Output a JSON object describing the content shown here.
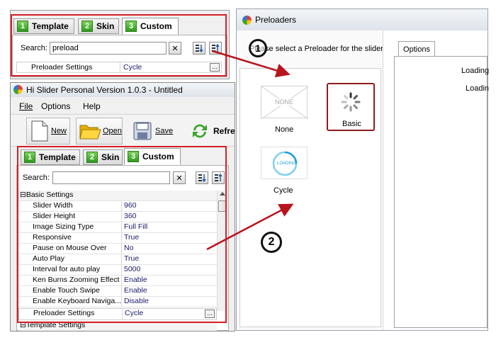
{
  "top_panel": {
    "tabs": [
      {
        "num": "1",
        "label": "Template"
      },
      {
        "num": "2",
        "label": "Skin"
      },
      {
        "num": "3",
        "label": "Custom"
      }
    ],
    "search_label": "Search:",
    "search_value": "preload",
    "clear_glyph": "✕",
    "row": {
      "name": "Preloader Settings",
      "value": "Cycle",
      "button": "..."
    }
  },
  "main_window": {
    "title": "Hi Slider Personal Version 1.0.3  - Untitled",
    "menu": [
      "File",
      "Options",
      "Help"
    ],
    "toolbar": [
      "New",
      "Open",
      "Save",
      "Refre"
    ],
    "tabs": [
      {
        "num": "1",
        "label": "Template"
      },
      {
        "num": "2",
        "label": "Skin"
      },
      {
        "num": "3",
        "label": "Custom"
      }
    ],
    "search_label": "Search:",
    "search_value": "",
    "clear_glyph": "✕",
    "group": "Basic Settings",
    "group_toggle": "⊟",
    "rows": [
      {
        "name": "Slider Width",
        "value": "960"
      },
      {
        "name": "Slider Height",
        "value": "360"
      },
      {
        "name": "Image Sizing Type",
        "value": "Full Fill"
      },
      {
        "name": "Responsive",
        "value": "True"
      },
      {
        "name": "Pause on Mouse Over",
        "value": "No"
      },
      {
        "name": "Auto Play",
        "value": "True"
      },
      {
        "name": "Interval for auto play",
        "value": "5000"
      },
      {
        "name": "Ken Burns Zooming Effect",
        "value": "Enable"
      },
      {
        "name": "Enable Touch Swipe",
        "value": "Enable"
      },
      {
        "name": "Enable Keyboard Naviga...",
        "value": "Disable"
      },
      {
        "name": "Preloader Settings",
        "value": "Cycle"
      }
    ],
    "ellipsis": "...",
    "next_group": "Template Settings",
    "next_group_toggle": "⊟"
  },
  "preloaders": {
    "title": "Preloaders",
    "instruction": "Please select a Preloader for the slider.",
    "options_tab": "Options",
    "items": [
      {
        "label": "None",
        "thumb_text": "NONE"
      },
      {
        "label": "Basic"
      },
      {
        "label": "Cycle",
        "thumb_text": "LOADING"
      }
    ],
    "loading_labels": [
      "Loading",
      "Loadin"
    ]
  },
  "annotations": {
    "step1": "1",
    "step2": "2"
  },
  "colors": {
    "highlight": "#d81e27",
    "tab_green": "#3aa52a",
    "selection_border": "#8b1c1c"
  }
}
